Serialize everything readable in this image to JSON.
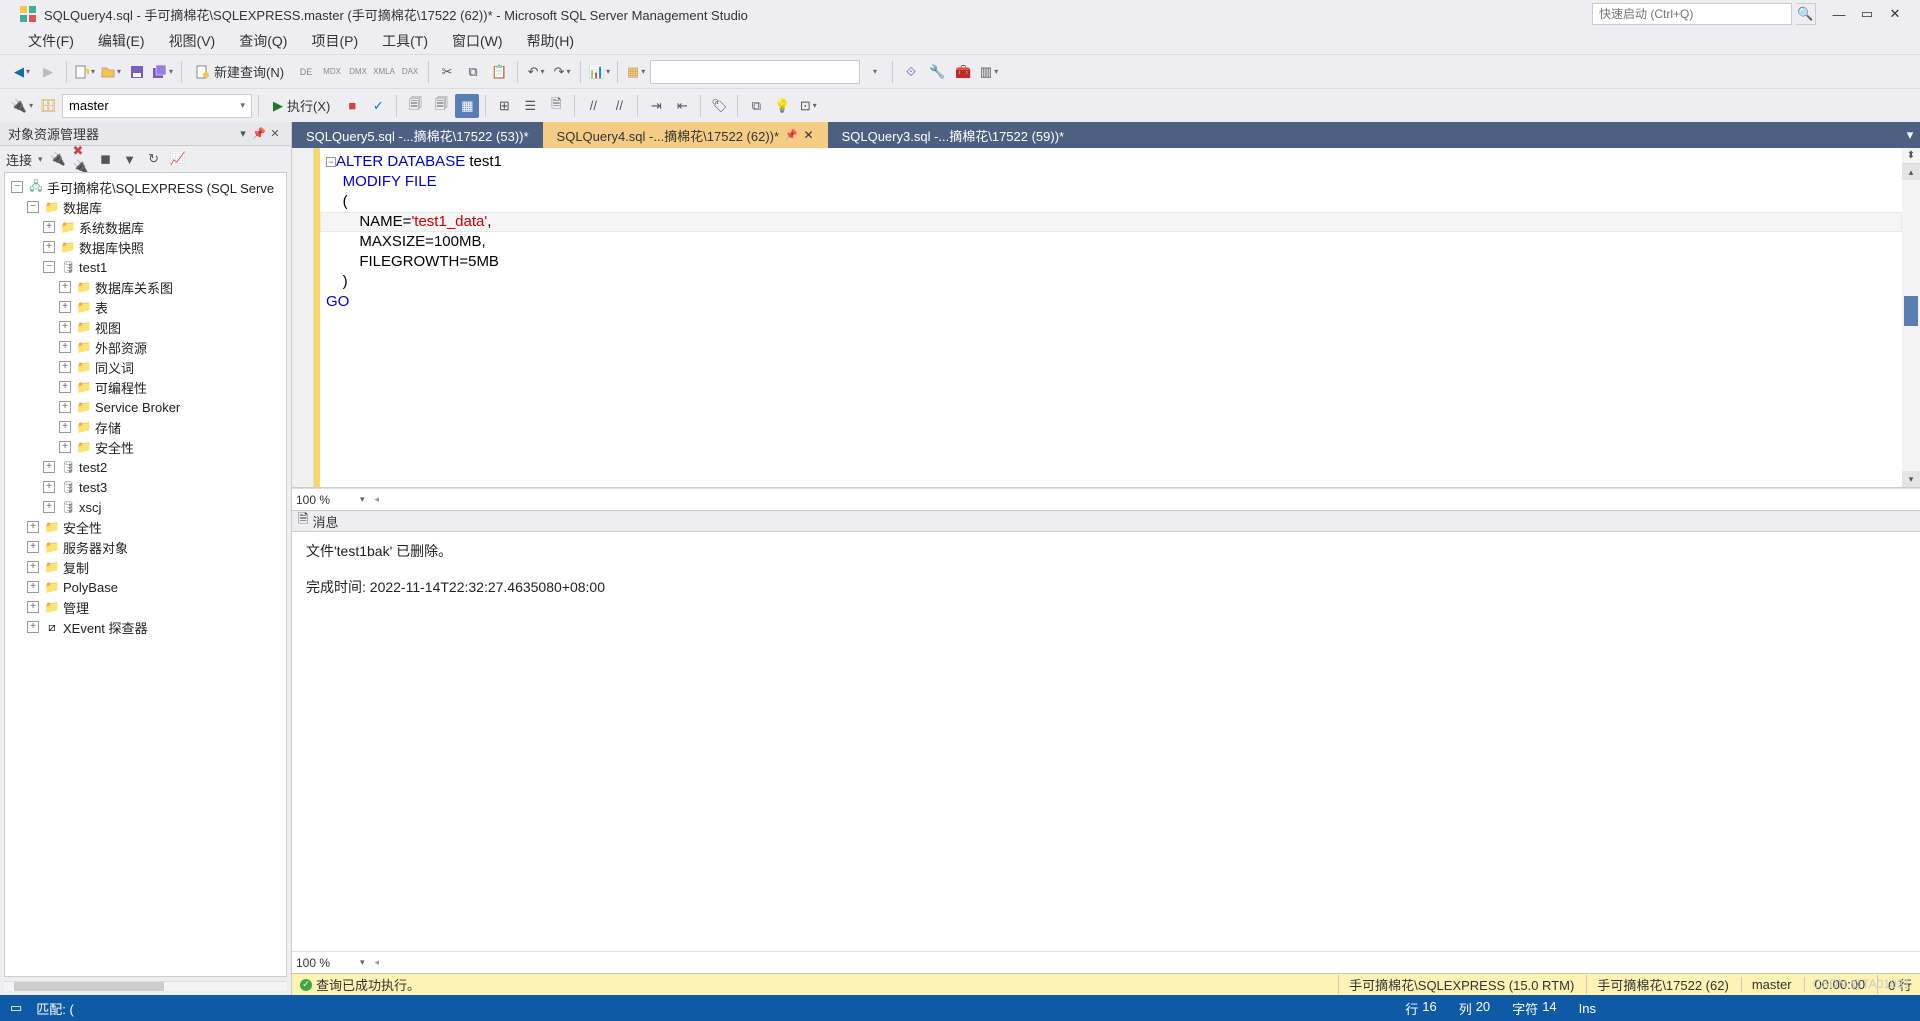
{
  "title": "SQLQuery4.sql - 手可摘棉花\\SQLEXPRESS.master (手可摘棉花\\17522 (62))* - Microsoft SQL Server Management Studio",
  "quick_launch_placeholder": "快速启动 (Ctrl+Q)",
  "menu": [
    "文件(F)",
    "编辑(E)",
    "视图(V)",
    "查询(Q)",
    "项目(P)",
    "工具(T)",
    "窗口(W)",
    "帮助(H)"
  ],
  "toolbar1": {
    "new_query": "新建查询(N)"
  },
  "toolbar2": {
    "db_selected": "master",
    "execute": "执行(X)"
  },
  "object_explorer": {
    "title": "对象资源管理器",
    "connect": "连接",
    "root": "手可摘棉花\\SQLEXPRESS (SQL Serve",
    "nodes": {
      "databases": "数据库",
      "sys_db": "系统数据库",
      "snapshot": "数据库快照",
      "test1": "test1",
      "diagrams": "数据库关系图",
      "tables": "表",
      "views": "视图",
      "external": "外部资源",
      "synonyms": "同义词",
      "programmability": "可编程性",
      "service_broker": "Service Broker",
      "storage": "存储",
      "security_db": "安全性",
      "test2": "test2",
      "test3": "test3",
      "xscj": "xscj",
      "security": "安全性",
      "server_objects": "服务器对象",
      "replication": "复制",
      "polybase": "PolyBase",
      "management": "管理",
      "xevent": "XEvent 探查器"
    }
  },
  "tabs": [
    {
      "label": "SQLQuery5.sql -...摘棉花\\17522 (53))*",
      "active": false
    },
    {
      "label": "SQLQuery4.sql -...摘棉花\\17522 (62))*",
      "active": true
    },
    {
      "label": "SQLQuery3.sql -...摘棉花\\17522 (59))*",
      "active": false
    }
  ],
  "code": {
    "l1_kw": "ALTER DATABASE",
    "l1_id": " test1",
    "l2_kw": "    MODIFY FILE",
    "l3": "    (",
    "l4_pre": "        NAME=",
    "l4_str": "'test1_data'",
    "l4_post": ",",
    "l5": "        MAXSIZE=100MB,",
    "l6": "        FILEGROWTH=5MB",
    "l7": "    )",
    "l8_kw": "GO"
  },
  "zoom": "100 %",
  "messages": {
    "header": "消息",
    "line1": "文件'test1bak' 已删除。",
    "line2": "完成时间: 2022-11-14T22:32:27.4635080+08:00"
  },
  "status": {
    "ok_text": "查询已成功执行。",
    "server": "手可摘棉花\\SQLEXPRESS (15.0 RTM)",
    "user": "手可摘棉花\\17522 (62)",
    "db": "master",
    "elapsed": "00:00:00",
    "rows": "0 行"
  },
  "footer": {
    "match": "匹配: (",
    "line_lbl": "行",
    "line": "16",
    "col_lbl": "列",
    "col": "20",
    "char_lbl": "字符",
    "char": "14",
    "ins": "Ins"
  },
  "watermark": "CSDN @TA01031"
}
